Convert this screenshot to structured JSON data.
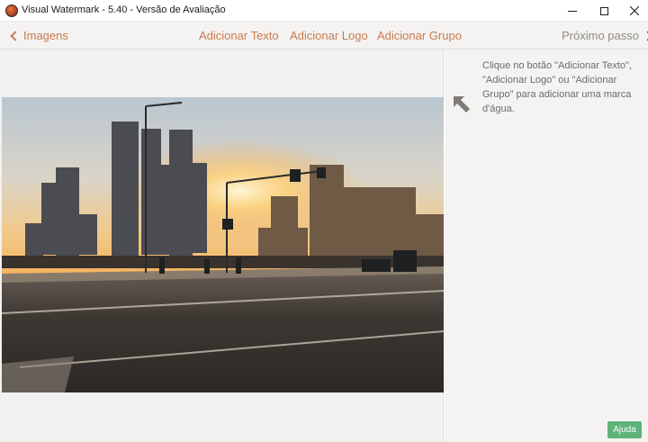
{
  "window": {
    "title": "Visual Watermark - 5.40 - Versão de Avaliação",
    "app_icon": "app-logo-icon"
  },
  "toolbar": {
    "back_label": "Imagens",
    "add_text_label": "Adicionar Texto",
    "add_logo_label": "Adicionar Logo",
    "add_group_label": "Adicionar Grupo",
    "next_label": "Próximo passo",
    "accent_color": "#c97a4e"
  },
  "side_panel": {
    "hint": "Clique no botão \"Adicionar Texto\", \"Adicionar Logo\" ou \"Adicionar Grupo\" para adicionar uma marca d'água.",
    "help_label": "Ajuda",
    "help_color": "#5fb37a"
  }
}
